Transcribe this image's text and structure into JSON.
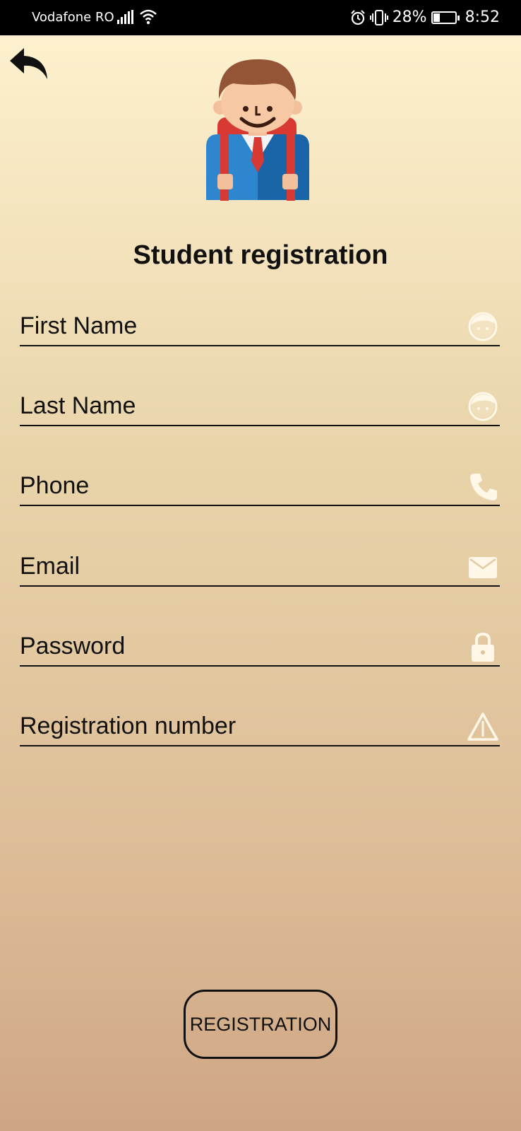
{
  "status_bar": {
    "carrier": "Vodafone RO",
    "battery": "28%",
    "battery_level": 0.28,
    "time": "8:52"
  },
  "header": {
    "title": "Student registration"
  },
  "form": {
    "fields": [
      {
        "placeholder": "First Name",
        "icon": "face-icon"
      },
      {
        "placeholder": "Last Name",
        "icon": "face-icon"
      },
      {
        "placeholder": "Phone",
        "icon": "phone-icon"
      },
      {
        "placeholder": "Email",
        "icon": "mail-icon"
      },
      {
        "placeholder": "Password",
        "icon": "lock-icon"
      },
      {
        "placeholder": "Registration number",
        "icon": "warning-icon"
      }
    ]
  },
  "actions": {
    "register_label": "REGISTRATION"
  },
  "colors": {
    "text": "#111111",
    "icon": "#fff7e8",
    "status_bar": "#000000"
  }
}
